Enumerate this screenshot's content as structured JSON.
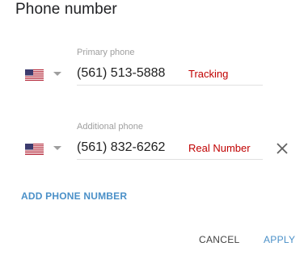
{
  "dialog": {
    "title": "Phone number"
  },
  "phones": [
    {
      "label": "Primary phone",
      "value": "(561) 513-5888",
      "annotation": "Tracking",
      "country_flag": "us-flag-icon"
    },
    {
      "label": "Additional phone",
      "value": "(561) 832-6262",
      "annotation": "Real Number",
      "country_flag": "us-flag-icon",
      "remove_icon": "close-icon"
    }
  ],
  "actions": {
    "add_phone": "ADD PHONE NUMBER",
    "cancel": "CANCEL",
    "apply": "APPLY"
  },
  "colors": {
    "accent": "#4a90c8",
    "annotation": "#c00000",
    "label": "#9e9e9e"
  }
}
